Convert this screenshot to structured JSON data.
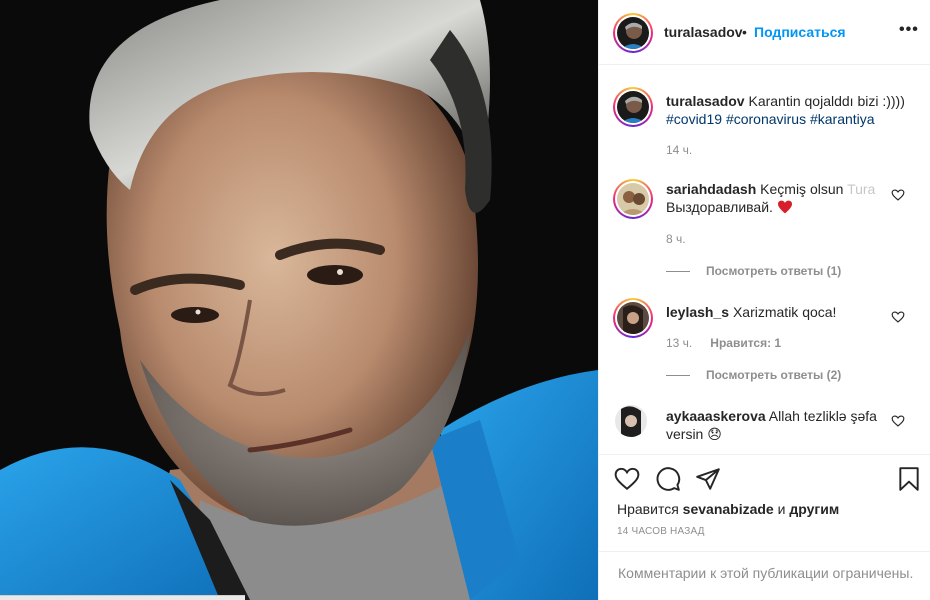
{
  "post": {
    "author": "turalasadov",
    "follow_label": "Подписаться",
    "more_label": "•••",
    "dot": "•"
  },
  "caption": {
    "username": "turalasadov",
    "text": "Karantin qojalddı bizi :))))",
    "hashtags": [
      "#covid19",
      "#coronavirus",
      "#karantiya"
    ],
    "time": "14 ч."
  },
  "comments": [
    {
      "username": "sariahdadash",
      "text": "Keçmiş olsun",
      "text_faded": "Tura",
      "text2": "Выздоравливай.",
      "emoji": "❤️",
      "time": "8 ч.",
      "replies": "Посмотреть ответы (1)"
    },
    {
      "username": "leylash_s",
      "text": "Xarizmatik qoca!",
      "time": "13 ч.",
      "likes": "Нравится: 1",
      "replies": "Посмотреть ответы (2)"
    },
    {
      "username": "aykaaaskerova",
      "text": "Allah tezliklə şəfa versin",
      "emoji": "😞"
    }
  ],
  "actions": {
    "liked_by_prefix": "Нравится",
    "liked_by_user": "sevanabizade",
    "liked_by_and": "и",
    "liked_by_others": "другим",
    "time_ago": "14 ЧАСОВ НАЗАД"
  },
  "comments_limited": "Комментарии к этой публикации ограничены.",
  "colors": {
    "accent": "#0095f6",
    "hashtag": "#00376b",
    "muted": "#8e8e8e",
    "heart": "#ed4956",
    "jacket": "#1e90d8"
  },
  "icons": {
    "like": "heart-icon",
    "comment": "comment-bubble-icon",
    "share": "paper-plane-icon",
    "save": "bookmark-icon",
    "more": "more-dots-icon",
    "comment_like": "small-heart-icon"
  }
}
